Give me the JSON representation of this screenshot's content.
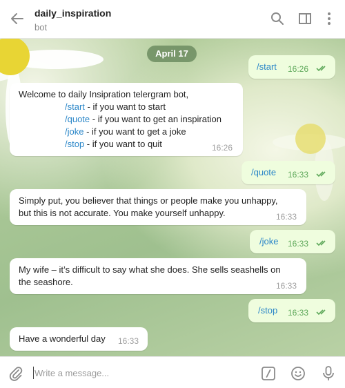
{
  "header": {
    "title": "daily_inspiration",
    "subtitle": "bot"
  },
  "date_label": "April 17",
  "messages": [
    {
      "from": "me",
      "text": "/start",
      "time": "16:26"
    },
    {
      "from": "bot",
      "intro": "Welcome to daily Insipration telergram bot,",
      "lines": [
        {
          "cmd": "/start",
          "rest": " - if you want to start"
        },
        {
          "cmd": "/quote",
          "rest": " - if you want to get an inspiration"
        },
        {
          "cmd": "/joke",
          "rest": " - if you want to get a joke"
        },
        {
          "cmd": "/stop",
          "rest": " - if you want to quit"
        }
      ],
      "time": "16:26"
    },
    {
      "from": "me",
      "text": "/quote",
      "time": "16:33"
    },
    {
      "from": "bot",
      "line1": "Simply put, you believer that things or people make you unhappy,",
      "line2": "but this is not accurate. You make yourself unhappy.",
      "time": "16:33"
    },
    {
      "from": "me",
      "text": "/joke",
      "time": "16:33"
    },
    {
      "from": "bot",
      "line1": "My wife – it’s difficult to say what she does. She sells seashells on",
      "line2": "the seashore.",
      "time": "16:33"
    },
    {
      "from": "me",
      "text": "/stop",
      "time": "16:33"
    },
    {
      "from": "bot",
      "text": "Have a wonderful day",
      "time": "16:33"
    }
  ],
  "composer": {
    "placeholder": "Write a message..."
  },
  "icons": {
    "back": "arrow-left-icon",
    "search": "search-icon",
    "sidebar": "sidebar-toggle-icon",
    "menu": "more-vertical-icon",
    "attach": "paperclip-icon",
    "commands": "slash-command-icon",
    "emoji": "emoji-icon",
    "mic": "microphone-icon",
    "read": "double-check-icon"
  },
  "colors": {
    "outgoing_bubble": "#effdde",
    "command_link": "#2a86c8",
    "read_check": "#5ea85a",
    "date_pill": "#6c8c60"
  }
}
